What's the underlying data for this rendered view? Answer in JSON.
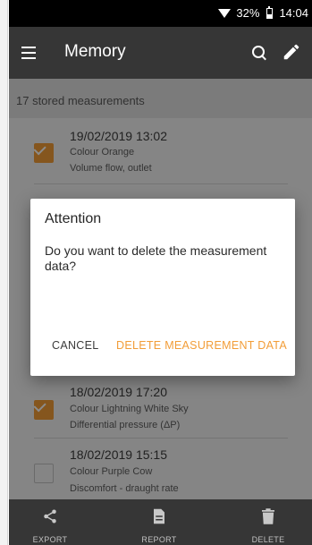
{
  "status_bar": {
    "battery": "32%",
    "time": "14:04"
  },
  "app_bar": {
    "title": "Memory"
  },
  "list": {
    "count_label": "17 stored measurements",
    "items": [
      {
        "date": "19/02/2019 13:02",
        "color": "Colour Orange",
        "type": "Volume flow, outlet",
        "checked": true
      },
      {
        "date": "18/02/2019 17:20",
        "color": "Colour Lightning White Sky",
        "type": "Differential pressure (ΔP)",
        "checked": true
      },
      {
        "date": "18/02/2019 15:15",
        "color": "Colour Purple Cow",
        "type": "Discomfort - draught rate",
        "checked": false
      }
    ]
  },
  "dialog": {
    "title": "Attention",
    "message": "Do you want to delete the measurement data?",
    "cancel_label": "CANCEL",
    "confirm_label": "DELETE MEASUREMENT DATA"
  },
  "bottom_nav": {
    "export_label": "EXPORT",
    "report_label": "REPORT",
    "delete_label": "DELETE"
  },
  "colors": {
    "accent": "#f29d38",
    "app_bar": "#363636",
    "status_bar": "#000000"
  }
}
